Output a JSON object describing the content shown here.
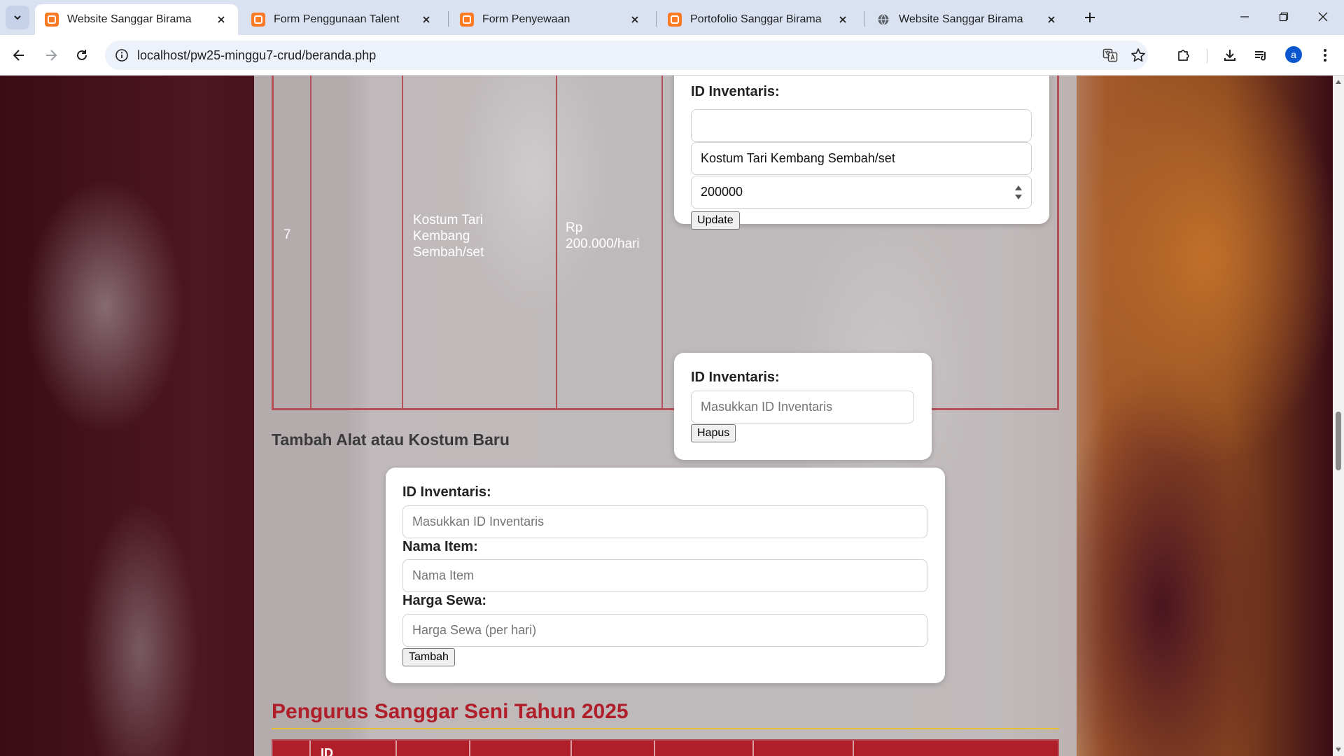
{
  "browser": {
    "tabs": [
      {
        "title": "Website Sanggar Birama",
        "active": true,
        "icon": "xampp-icon"
      },
      {
        "title": "Form Penggunaan Talent",
        "active": false,
        "icon": "xampp-icon"
      },
      {
        "title": "Form Penyewaan",
        "active": false,
        "icon": "xampp-icon"
      },
      {
        "title": "Portofolio Sanggar Birama",
        "active": false,
        "icon": "xampp-icon"
      },
      {
        "title": "Website Sanggar Birama",
        "active": false,
        "icon": "globe-icon"
      }
    ],
    "url": "localhost/pw25-minggu7-crud/beranda.php",
    "profile_initial": "a",
    "accent": "#0b57d0"
  },
  "inventory_row": {
    "number": "7",
    "item_name": "Kostum Tari Kembang Sembah/set",
    "price": "Rp 200.000/hari",
    "update_form": {
      "label": "ID Inventaris:",
      "id_value": "",
      "name_value": "Kostum Tari Kembang Sembah/set",
      "price_value": "200000",
      "button": "Update"
    },
    "delete_form": {
      "label": "ID Inventaris:",
      "placeholder": "Masukkan ID Inventaris",
      "button": "Hapus"
    }
  },
  "add_section": {
    "heading": "Tambah Alat atau Kostum Baru",
    "id_label": "ID Inventaris:",
    "id_placeholder": "Masukkan ID Inventaris",
    "name_label": "Nama Item:",
    "name_placeholder": "Nama Item",
    "price_label": "Harga Sewa:",
    "price_placeholder": "Harga Sewa (per hari)",
    "button": "Tambah"
  },
  "pengurus": {
    "heading": "Pengurus Sanggar Seni Tahun 2025",
    "first_header_partial": "ID",
    "heading_color": "#b01e2a",
    "rule_color": "#e5c13a"
  }
}
